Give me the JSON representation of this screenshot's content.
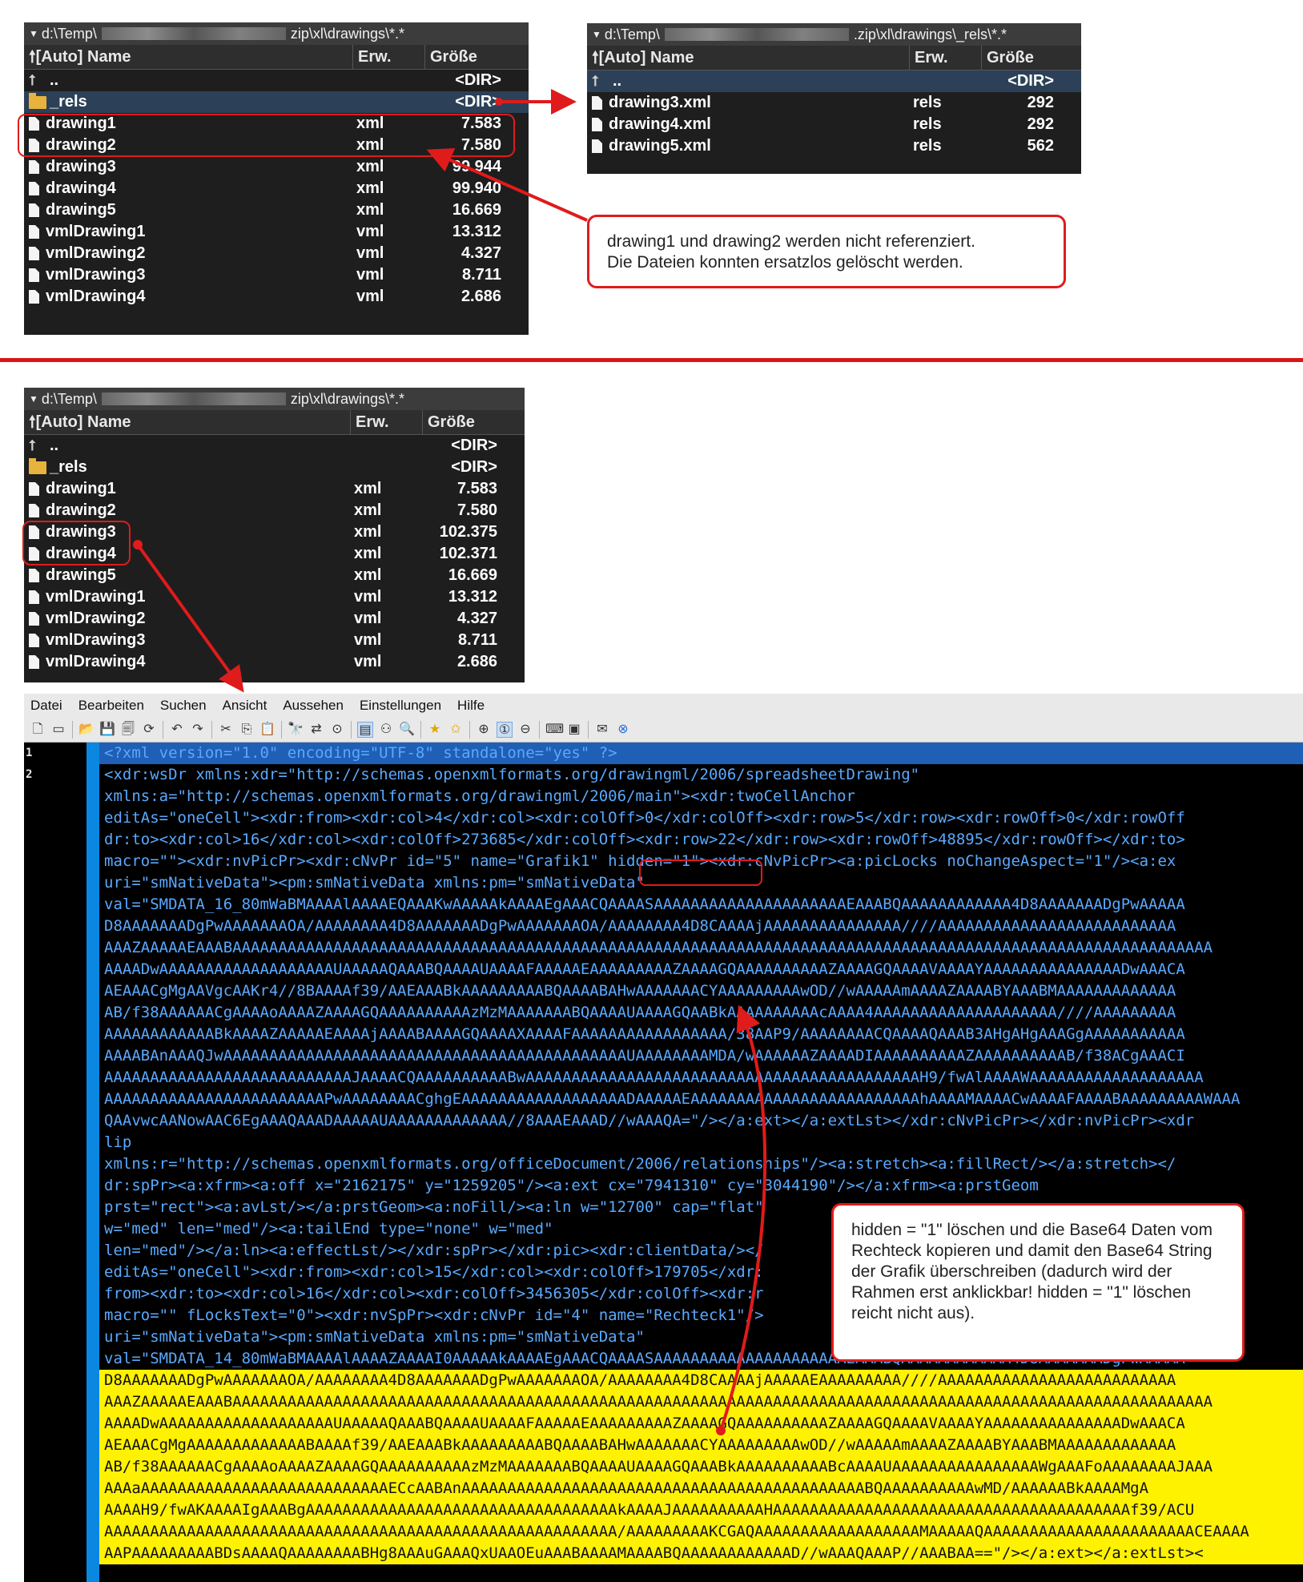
{
  "colors": {
    "red": "#e01b1b",
    "panel_bg": "#1e1e1e",
    "selection": "#2c4158",
    "editor_blue": "#0a87e0",
    "highlight": "#fff200"
  },
  "panel_top_left": {
    "path_left": "d:\\Temp\\",
    "path_right": "zip\\xl\\drawings\\*.*",
    "columns": {
      "name": "[Auto] Name",
      "ext": "Erw.",
      "size": "Größe"
    },
    "rows": [
      {
        "icon": "up-icon",
        "name": "..",
        "ext": "",
        "size": "<DIR>"
      },
      {
        "icon": "folder-icon",
        "name": "_rels",
        "ext": "",
        "size": "<DIR>",
        "selected": true
      },
      {
        "icon": "file-icon",
        "name": "drawing1",
        "ext": "xml",
        "size": "7.583"
      },
      {
        "icon": "file-icon",
        "name": "drawing2",
        "ext": "xml",
        "size": "7.580"
      },
      {
        "icon": "file-icon",
        "name": "drawing3",
        "ext": "xml",
        "size": "99.944"
      },
      {
        "icon": "file-icon",
        "name": "drawing4",
        "ext": "xml",
        "size": "99.940"
      },
      {
        "icon": "file-icon",
        "name": "drawing5",
        "ext": "xml",
        "size": "16.669"
      },
      {
        "icon": "file-icon",
        "name": "vmlDrawing1",
        "ext": "vml",
        "size": "13.312"
      },
      {
        "icon": "file-icon",
        "name": "vmlDrawing2",
        "ext": "vml",
        "size": "4.327"
      },
      {
        "icon": "file-icon",
        "name": "vmlDrawing3",
        "ext": "vml",
        "size": "8.711"
      },
      {
        "icon": "file-icon",
        "name": "vmlDrawing4",
        "ext": "vml",
        "size": "2.686"
      }
    ]
  },
  "panel_top_right": {
    "path_left": "d:\\Temp\\",
    "path_right": ".zip\\xl\\drawings\\_rels\\*.*",
    "columns": {
      "name": "[Auto] Name",
      "ext": "Erw.",
      "size": "Größe"
    },
    "rows": [
      {
        "icon": "up-icon",
        "name": "..",
        "ext": "",
        "size": "<DIR>",
        "selected": true
      },
      {
        "icon": "file-icon",
        "name": "drawing3.xml",
        "ext": "rels",
        "size": "292"
      },
      {
        "icon": "file-icon",
        "name": "drawing4.xml",
        "ext": "rels",
        "size": "292"
      },
      {
        "icon": "file-icon",
        "name": "drawing5.xml",
        "ext": "rels",
        "size": "562"
      }
    ]
  },
  "callout_top": {
    "line1": "drawing1 und drawing2 werden nicht referenziert.",
    "line2": "Die Dateien konnten ersatzlos gelöscht werden."
  },
  "panel_bottom": {
    "path_left": "d:\\Temp\\",
    "path_right": "zip\\xl\\drawings\\*.*",
    "columns": {
      "name": "[Auto] Name",
      "ext": "Erw.",
      "size": "Größe"
    },
    "rows": [
      {
        "icon": "up-icon",
        "name": "..",
        "ext": "",
        "size": "<DIR>"
      },
      {
        "icon": "folder-icon",
        "name": "_rels",
        "ext": "",
        "size": "<DIR>"
      },
      {
        "icon": "file-icon",
        "name": "drawing1",
        "ext": "xml",
        "size": "7.583"
      },
      {
        "icon": "file-icon",
        "name": "drawing2",
        "ext": "xml",
        "size": "7.580"
      },
      {
        "icon": "file-icon",
        "name": "drawing3",
        "ext": "xml",
        "size": "102.375"
      },
      {
        "icon": "file-icon",
        "name": "drawing4",
        "ext": "xml",
        "size": "102.371"
      },
      {
        "icon": "file-icon",
        "name": "drawing5",
        "ext": "xml",
        "size": "16.669"
      },
      {
        "icon": "file-icon",
        "name": "vmlDrawing1",
        "ext": "vml",
        "size": "13.312"
      },
      {
        "icon": "file-icon",
        "name": "vmlDrawing2",
        "ext": "vml",
        "size": "4.327"
      },
      {
        "icon": "file-icon",
        "name": "vmlDrawing3",
        "ext": "vml",
        "size": "8.711"
      },
      {
        "icon": "file-icon",
        "name": "vmlDrawing4",
        "ext": "vml",
        "size": "2.686"
      }
    ]
  },
  "editor": {
    "menu": [
      "Datei",
      "Bearbeiten",
      "Suchen",
      "Ansicht",
      "Aussehen",
      "Einstellungen",
      "Hilfe"
    ],
    "toolbar_icons": [
      "new-file-icon",
      "new-window-icon",
      "open-folder-icon",
      "save-icon",
      "save-all-icon",
      "reload-icon",
      "undo-icon",
      "redo-icon",
      "cut-icon",
      "copy-icon",
      "paste-icon",
      "find-icon",
      "replace-icon",
      "goto-icon",
      "wrap-icon",
      "tree-icon",
      "zoom-icon",
      "bookmark-icon",
      "bookmark-all-icon",
      "zoom-in-icon",
      "zoom-reset-icon",
      "zoom-out-icon",
      "keyboard-icon",
      "terminal-icon",
      "send-icon",
      "close-icon"
    ],
    "line_numbers": [
      "1",
      "2"
    ],
    "lines": [
      "<?xml version=\"1.0\" encoding=\"UTF-8\" standalone=\"yes\" ?>",
      "<xdr:wsDr xmlns:xdr=\"http://schemas.openxmlformats.org/drawingml/2006/spreadsheetDrawing\"",
      "xmlns:a=\"http://schemas.openxmlformats.org/drawingml/2006/main\"><xdr:twoCellAnchor",
      "editAs=\"oneCell\"><xdr:from><xdr:col>4</xdr:col><xdr:colOff>0</xdr:colOff><xdr:row>5</xdr:row><xdr:rowOff>0</xdr:rowOff",
      "dr:to><xdr:col>16</xdr:col><xdr:colOff>273685</xdr:colOff><xdr:row>22</xdr:row><xdr:rowOff>48895</xdr:rowOff></xdr:to>",
      "macro=\"\"><xdr:nvPicPr><xdr:cNvPr id=\"5\" name=\"Grafik1\" hidden=\"1\"><xdr:cNvPicPr><a:picLocks noChangeAspect=\"1\"/><a:ex",
      "uri=\"smNativeData\"><pm:smNativeData xmlns:pm=\"smNativeData\"",
      "val=\"SMDATA_16_80mWaBMAAAAlAAAAEQAAAKwAAAAAkAAAAEgAAACQAAAASAAAAAAAAAAAAAAAAAAAAAEAAABQAAAAAAAAAAAA4D8AAAAAAADgPwAAAAA",
      "D8AAAAAAADgPwAAAAAAAOA/AAAAAAAA4D8AAAAAAADgPwAAAAAAAOA/AAAAAAAA4D8CAAAAjAAAAAAAAAAAAAAA////AAAAAAAAAAAAAAAAAAAAAAAAAA",
      "AAAZAAAAAEAAABAAAAAAAAAAAAAAAAAAAAAAAAAAAAAAAAAAAAAAAAAAAAAAAAAAAAAAAAAAAAAAAAAAAAAAAAAAAAAAAAAAAAAAAAAAAAAAAAAAAAAAAAAAA",
      "AAAADwAAAAAAAAAAAAAAAAAAAUAAAAAQAAABQAAAAUAAAAFAAAAAEAAAAAAAAAZAAAAGQAAAAAAAAAAZAAAAGQAAAAVAAAAYAAAAAAAAAAAAAAADwAAACA",
      "AEAAACgMgAAVgcAAKr4//8BAAAAf39/AAEAAABkAAAAAAAAABQAAAABAHwAAAAAAACYAAAAAAAAAwOD//wAAAAAmAAAAZAAAABYAAABMAAAAAAAAAAAAA",
      "AB/f38AAAAAACgAAAAoAAAAZAAAAGQAAAAAAAAAAzMzMAAAAAAABQAAAAUAAAAGQAABkAAAAAAAAAAcAAAA4AAAAAAAAAAAAAAAAAAAA////AAAAAAAAA",
      "AAAAAAAAAAAABkAAAAZAAAAAEAAAAjAAAABAAAAGQAAAAXAAAAFAAAAAAAAAAAAAAAAA/38AAP9/AAAAAAAACQAAAAQAAAB3AHgAHgAAAGgAAAAAAAAAAA",
      "AAAABAnAAAQJwAAAAAAAAAAAAAAAAAAAAAAAAAAAAAAAAAAAAAAAAAAAAUAAAAAAAAMDA/wAAAAAAZAAAADIAAAAAAAAAAZAAAAAAAAAAB/f38ACgAAACI",
      "AAAAAAAAAAAAAAAAAAAAAAAAAAAJAAAACQAAAAAAAAAABwAAAAAAAAAAAAAAAAAAAAAAAAAAAAAAAAAAAAAAAAAAAH9/fwAlAAAAWAAAAAAAAAAAAAAAAAAA",
      "AAAAAAAAAAAAAAAAAAAAAAAAPwAAAAAAAACghgEAAAAAAAAAAAAAAAAAADAAAAAEAAAAAAAAAAAAAAAAAAAAAAAAAhAAAAMAAAACwAAAAFAAAABAAAAAAAAAWAAA",
      "QAAvwcAANowAAC6EgAAAQAAADAAAAAUAAAAAAAAAAAAA//8AAAEAAAD//wAAAQA=\"/></a:ext></a:extLst></xdr:cNvPicPr></xdr:nvPicPr><xdr",
      "lip",
      "xmlns:r=\"http://schemas.openxmlformats.org/officeDocument/2006/relationships\"/><a:stretch><a:fillRect/></a:stretch></",
      "dr:spPr><a:xfrm><a:off x=\"2162175\" y=\"1259205\"/><a:ext cx=\"7941310\" cy=\"3044190\"/></a:xfrm><a:prstGeom",
      "prst=\"rect\"><a:avLst/></a:prstGeom><a:noFill/><a:ln w=\"12700\" cap=\"flat\"",
      "w=\"med\" len=\"med\"/><a:tailEnd type=\"none\" w=\"med\"",
      "len=\"med\"/></a:ln><a:effectLst/></xdr:spPr></xdr:pic><xdr:clientData/></",
      "editAs=\"oneCell\"><xdr:from><xdr:col>15</xdr:col><xdr:colOff>179705</xdr:",
      "from><xdr:to><xdr:col>16</xdr:col><xdr:colOff>3456305</xdr:colOff><xdr:r",
      "macro=\"\" fLocksText=\"0\"><xdr:nvSpPr><xdr:cNvPr id=\"4\" name=\"Rechteck1\"/>",
      "uri=\"smNativeData\"><pm:smNativeData xmlns:pm=\"smNativeData\"",
      "val=\"SMDATA_14_80mWaBMAAAAlAAAAZAAAAI0AAAAAkAAAAEgAAACQAAAASAAAAAAAAAAAAAAAAAAAAAEAAABQAAAAAAAAAAAA4D8AAAAAAADgPwAAAAA",
      "D8AAAAAAADgPwAAAAAAAOA/AAAAAAAA4D8AAAAAAADgPwAAAAAAAOA/AAAAAAAA4D8CAAAAjAAAAAEAAAAAAAAA////AAAAAAAAAAAAAAAAAAAAAAAAAA",
      "AAAZAAAAAEAAABAAAAAAAAAAAAAAAAAAAAAAAAAAAAAAAAAAAAAAAAAAAAAAAAAAAAAAAAAAAAAAAAAAAAAAAAAAAAAAAAAAAAAAAAAAAAAAAAAAAAAAAAAAA",
      "AAAADwAAAAAAAAAAAAAAAAAAAUAAAAAQAAABQAAAAUAAAAFAAAAAEAAAAAAAAAZAAAAGQAAAAAAAAAAZAAAAGQAAAAVAAAAYAAAAAAAAAAAAAAADwAAACA",
      "AEAAACgMgAAAAAAAAAAAAABAAAAf39/AAEAAABkAAAAAAAAABQAAAABAHwAAAAAAACYAAAAAAAAAwOD//wAAAAAmAAAAZAAAABYAAABMAAAAAAAAAAAAA",
      "AB/f38AAAAAACgAAAAoAAAAZAAAAGQAAAAAAAAAAzMzMAAAAAAABQAAAAUAAAAGQAAABkAAAAAAAAAABcAAAAUAAAAAAAAAAAAAAAAWgAAAFoAAAAAAAAJAAA",
      "AAAaAAAAAAAAAAAAAAAAAAAAAAAAAAAECcAABAnAAAAAAAAAAAAAAAAAAAAAAAAAAAAAAAAAAAAAAAAAAAABQAAAAAAAAAAwMD/AAAAAABkAAAAMgA",
      "AAAAH9/fwAKAAAAIgAAABgAAAAAAAAAAAAAAAAAAAAAAAAAAAAAAAAAAkAAAAJAAAAAAAAAAHAAAAAAAAAAAAAAAAAAAAAAAAAAAAAAAAAAAAAAAf39/ACU",
      "AAAAAAAAAAAAAAAAAAAAAAAAAAAAAAAAAAAAAAAAAAAAAAAAAAAAAAAA/AAAAAAAAAKCGAQAAAAAAAAAAAAAAAAAAMAAAAAQAAAAAAAAAAAAAAAAAAAAAAACEAAAA",
      "AAPAAAAAAAAABDsAAAAQAAAAAAAABHg8AAAuGAAAQxUAAOEuAAABAAAAMAAAABQAAAAAAAAAAAAD//wAAAQAAAP//AAABAA==\"/></a:ext></a:extLst><"
    ]
  },
  "hidden_marker": "hidden=\"1\"",
  "callout_bottom": {
    "text": "hidden = \"1\" löschen und die Base64 Daten vom Rechteck kopieren und damit den Base64 String der Grafik überschreiben (dadurch wird der Rahmen erst anklickbar! hidden = \"1\" löschen reicht nicht aus)."
  }
}
